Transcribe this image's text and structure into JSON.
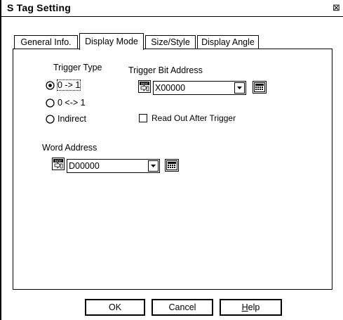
{
  "window": {
    "title": "S Tag Setting",
    "close_glyph": "⊠"
  },
  "tabs": [
    {
      "label": "General Info."
    },
    {
      "label": "Display Mode"
    },
    {
      "label": "Size/Style"
    },
    {
      "label": "Display Angle"
    }
  ],
  "trigger_type": {
    "label": "Trigger Type",
    "options": [
      {
        "label": "0 -> 1"
      },
      {
        "label": "0 <-> 1"
      },
      {
        "label": "Indirect"
      }
    ],
    "selected": "0 -> 1"
  },
  "trigger_bit_address": {
    "label": "Trigger Bit Address",
    "value": "X00000"
  },
  "read_out": {
    "label": "Read Out After Trigger",
    "checked": false
  },
  "word_address": {
    "label": "Word Address",
    "value": "D00000"
  },
  "buttons": {
    "ok": "OK",
    "cancel": "Cancel",
    "help": "Help"
  }
}
